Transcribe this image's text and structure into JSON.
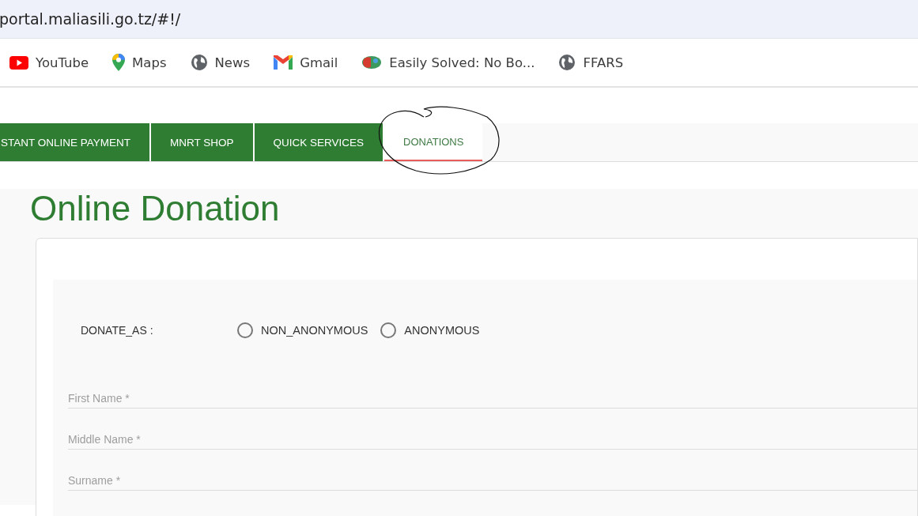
{
  "address_bar": {
    "url": "portal.maliasili.go.tz/#!/"
  },
  "bookmarks": [
    {
      "label": "YouTube",
      "kind": "youtube"
    },
    {
      "label": "Maps",
      "kind": "maps"
    },
    {
      "label": "News",
      "kind": "globe"
    },
    {
      "label": "Gmail",
      "kind": "gmail"
    },
    {
      "label": "Easily Solved: No Bo...",
      "kind": "brain"
    },
    {
      "label": "FFARS",
      "kind": "globe"
    }
  ],
  "tabs": [
    {
      "label": "STANT ONLINE PAYMENT",
      "selected": false
    },
    {
      "label": "MNRT SHOP",
      "selected": false
    },
    {
      "label": "QUICK SERVICES",
      "selected": false
    },
    {
      "label": "DONATIONS",
      "selected": true
    }
  ],
  "page_title": "Online Donation",
  "donate_as": {
    "label": "DONATE_AS :",
    "options": [
      {
        "label": "NON_ANONYMOUS",
        "selected": false
      },
      {
        "label": "ANONYMOUS",
        "selected": false
      }
    ]
  },
  "fields": [
    {
      "placeholder": "First Name *"
    },
    {
      "placeholder": "Middle Name *"
    },
    {
      "placeholder": "Surname *"
    }
  ]
}
